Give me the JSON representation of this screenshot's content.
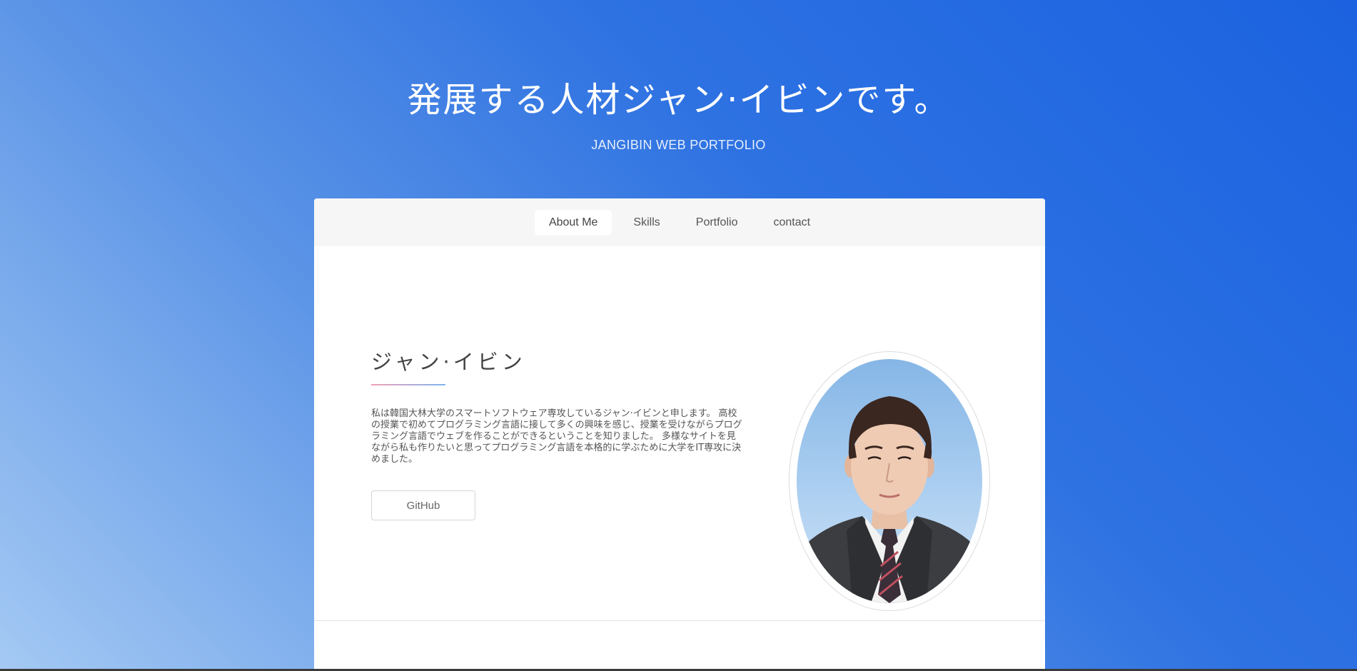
{
  "hero": {
    "title": "発展する人材ジャン·イビンです。",
    "subtitle": "JANGIBIN WEB PORTFOLIO"
  },
  "nav": {
    "tabs": [
      {
        "label": "About Me",
        "active": true
      },
      {
        "label": "Skills",
        "active": false
      },
      {
        "label": "Portfolio",
        "active": false
      },
      {
        "label": "contact",
        "active": false
      }
    ]
  },
  "about": {
    "name": "ジャン·イビン",
    "bio": "私は韓国大林大学のスマートソフトウェア専攻しているジャン·イビンと申します。 高校の授業で初めてプログラミング言語に接して多くの興味を感じ、授業を受けながらプログラミング言語でウェブを作ることができるということを知りました。 多様なサイトを見ながら私も作りたいと思ってプログラミング言語を本格的に学ぶために大学をIT専攻に決めました。",
    "github_label": "GitHub"
  },
  "colors": {
    "gradient_start": "#a4c9f3",
    "gradient_end": "#1b62e0",
    "underline_pink": "#f3a0b5",
    "underline_blue": "#7fb5f0"
  }
}
